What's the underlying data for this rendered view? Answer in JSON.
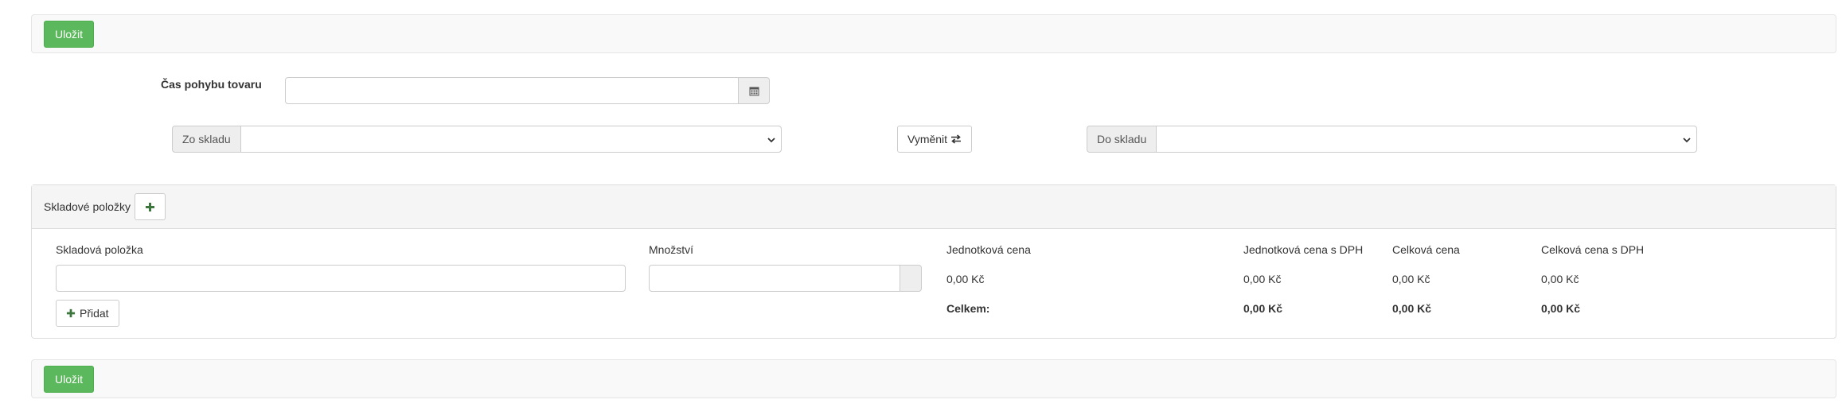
{
  "toolbar_top": {
    "save_label": "Uložit"
  },
  "toolbar_bottom": {
    "save_label": "Uložit"
  },
  "movement": {
    "time_label": "Čas pohybu tovaru",
    "time_value": "",
    "from_label": "Zo skladu",
    "from_value": "",
    "swap_label": "Vyměnit",
    "to_label": "Do skladu",
    "to_value": ""
  },
  "items_panel": {
    "title": "Skladové položky",
    "columns": {
      "item": "Skladová položka",
      "quantity": "Množství",
      "unit_price": "Jednotková cena",
      "unit_price_vat": "Jednotková cena s DPH",
      "total_price": "Celková cena",
      "total_price_vat": "Celková cena s DPH"
    },
    "row": {
      "item_value": "",
      "quantity_value": "",
      "unit_price": "0,00 Kč",
      "unit_price_vat": "0,00 Kč",
      "total_price": "0,00 Kč",
      "total_price_vat": "0,00 Kč"
    },
    "add_label": "Přidat",
    "totals": {
      "label": "Celkem:",
      "unit_price_vat": "0,00 Kč",
      "total_price": "0,00 Kč",
      "total_price_vat": "0,00 Kč"
    }
  },
  "icons": {
    "calendar": "calendar-icon",
    "swap": "exchange-icon",
    "plus": "plus-icon",
    "chevron": "chevron-down-icon"
  },
  "colors": {
    "success": "#5cb85c",
    "plus_green": "#3c763d"
  }
}
